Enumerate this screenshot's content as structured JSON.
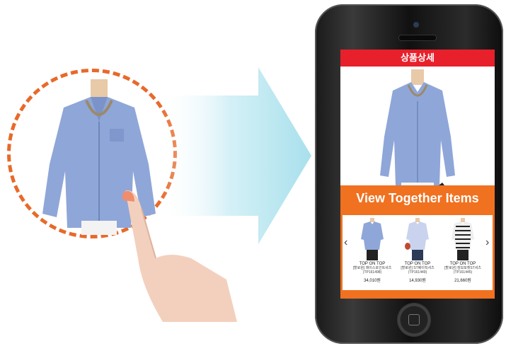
{
  "screen": {
    "header_title": "상품상세",
    "together_title": "View Together Items",
    "prev_label": "‹",
    "next_label": "›",
    "items": [
      {
        "brand": "TOP ON TOP",
        "name": "[할로윈] 레이스포인트셔츠(TP161498)",
        "price": "34,010원"
      },
      {
        "brand": "TOP ON TOP",
        "name": "[할로윈] ST베이직셔츠(TP161449)",
        "price": "14,930원"
      },
      {
        "brand": "TOP ON TOP",
        "name": "[할로윈] 잠보포켓ST셔츠(TP161445)",
        "price": "21,660원"
      }
    ]
  },
  "colors": {
    "header": "#e8202b",
    "together_bg": "#f07120",
    "dashed_circle": "#e8692a",
    "arrow": "#a8e0ec"
  }
}
